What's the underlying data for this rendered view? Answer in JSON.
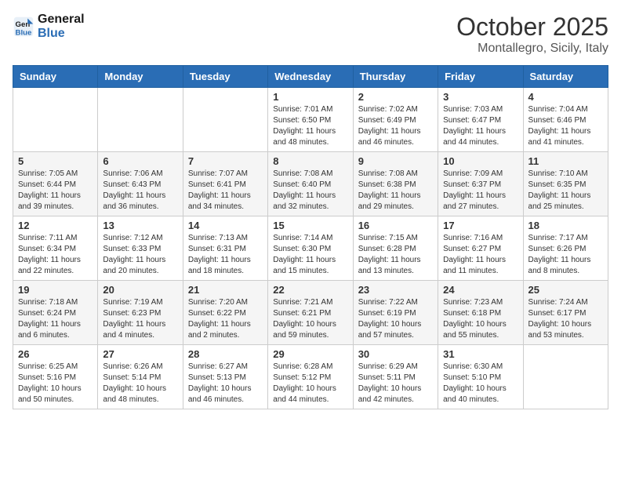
{
  "header": {
    "logo_line1": "General",
    "logo_line2": "Blue",
    "month": "October 2025",
    "location": "Montallegro, Sicily, Italy"
  },
  "days_of_week": [
    "Sunday",
    "Monday",
    "Tuesday",
    "Wednesday",
    "Thursday",
    "Friday",
    "Saturday"
  ],
  "weeks": [
    [
      {
        "day": "",
        "info": ""
      },
      {
        "day": "",
        "info": ""
      },
      {
        "day": "",
        "info": ""
      },
      {
        "day": "1",
        "info": "Sunrise: 7:01 AM\nSunset: 6:50 PM\nDaylight: 11 hours\nand 48 minutes."
      },
      {
        "day": "2",
        "info": "Sunrise: 7:02 AM\nSunset: 6:49 PM\nDaylight: 11 hours\nand 46 minutes."
      },
      {
        "day": "3",
        "info": "Sunrise: 7:03 AM\nSunset: 6:47 PM\nDaylight: 11 hours\nand 44 minutes."
      },
      {
        "day": "4",
        "info": "Sunrise: 7:04 AM\nSunset: 6:46 PM\nDaylight: 11 hours\nand 41 minutes."
      }
    ],
    [
      {
        "day": "5",
        "info": "Sunrise: 7:05 AM\nSunset: 6:44 PM\nDaylight: 11 hours\nand 39 minutes."
      },
      {
        "day": "6",
        "info": "Sunrise: 7:06 AM\nSunset: 6:43 PM\nDaylight: 11 hours\nand 36 minutes."
      },
      {
        "day": "7",
        "info": "Sunrise: 7:07 AM\nSunset: 6:41 PM\nDaylight: 11 hours\nand 34 minutes."
      },
      {
        "day": "8",
        "info": "Sunrise: 7:08 AM\nSunset: 6:40 PM\nDaylight: 11 hours\nand 32 minutes."
      },
      {
        "day": "9",
        "info": "Sunrise: 7:08 AM\nSunset: 6:38 PM\nDaylight: 11 hours\nand 29 minutes."
      },
      {
        "day": "10",
        "info": "Sunrise: 7:09 AM\nSunset: 6:37 PM\nDaylight: 11 hours\nand 27 minutes."
      },
      {
        "day": "11",
        "info": "Sunrise: 7:10 AM\nSunset: 6:35 PM\nDaylight: 11 hours\nand 25 minutes."
      }
    ],
    [
      {
        "day": "12",
        "info": "Sunrise: 7:11 AM\nSunset: 6:34 PM\nDaylight: 11 hours\nand 22 minutes."
      },
      {
        "day": "13",
        "info": "Sunrise: 7:12 AM\nSunset: 6:33 PM\nDaylight: 11 hours\nand 20 minutes."
      },
      {
        "day": "14",
        "info": "Sunrise: 7:13 AM\nSunset: 6:31 PM\nDaylight: 11 hours\nand 18 minutes."
      },
      {
        "day": "15",
        "info": "Sunrise: 7:14 AM\nSunset: 6:30 PM\nDaylight: 11 hours\nand 15 minutes."
      },
      {
        "day": "16",
        "info": "Sunrise: 7:15 AM\nSunset: 6:28 PM\nDaylight: 11 hours\nand 13 minutes."
      },
      {
        "day": "17",
        "info": "Sunrise: 7:16 AM\nSunset: 6:27 PM\nDaylight: 11 hours\nand 11 minutes."
      },
      {
        "day": "18",
        "info": "Sunrise: 7:17 AM\nSunset: 6:26 PM\nDaylight: 11 hours\nand 8 minutes."
      }
    ],
    [
      {
        "day": "19",
        "info": "Sunrise: 7:18 AM\nSunset: 6:24 PM\nDaylight: 11 hours\nand 6 minutes."
      },
      {
        "day": "20",
        "info": "Sunrise: 7:19 AM\nSunset: 6:23 PM\nDaylight: 11 hours\nand 4 minutes."
      },
      {
        "day": "21",
        "info": "Sunrise: 7:20 AM\nSunset: 6:22 PM\nDaylight: 11 hours\nand 2 minutes."
      },
      {
        "day": "22",
        "info": "Sunrise: 7:21 AM\nSunset: 6:21 PM\nDaylight: 10 hours\nand 59 minutes."
      },
      {
        "day": "23",
        "info": "Sunrise: 7:22 AM\nSunset: 6:19 PM\nDaylight: 10 hours\nand 57 minutes."
      },
      {
        "day": "24",
        "info": "Sunrise: 7:23 AM\nSunset: 6:18 PM\nDaylight: 10 hours\nand 55 minutes."
      },
      {
        "day": "25",
        "info": "Sunrise: 7:24 AM\nSunset: 6:17 PM\nDaylight: 10 hours\nand 53 minutes."
      }
    ],
    [
      {
        "day": "26",
        "info": "Sunrise: 6:25 AM\nSunset: 5:16 PM\nDaylight: 10 hours\nand 50 minutes."
      },
      {
        "day": "27",
        "info": "Sunrise: 6:26 AM\nSunset: 5:14 PM\nDaylight: 10 hours\nand 48 minutes."
      },
      {
        "day": "28",
        "info": "Sunrise: 6:27 AM\nSunset: 5:13 PM\nDaylight: 10 hours\nand 46 minutes."
      },
      {
        "day": "29",
        "info": "Sunrise: 6:28 AM\nSunset: 5:12 PM\nDaylight: 10 hours\nand 44 minutes."
      },
      {
        "day": "30",
        "info": "Sunrise: 6:29 AM\nSunset: 5:11 PM\nDaylight: 10 hours\nand 42 minutes."
      },
      {
        "day": "31",
        "info": "Sunrise: 6:30 AM\nSunset: 5:10 PM\nDaylight: 10 hours\nand 40 minutes."
      },
      {
        "day": "",
        "info": ""
      }
    ]
  ]
}
